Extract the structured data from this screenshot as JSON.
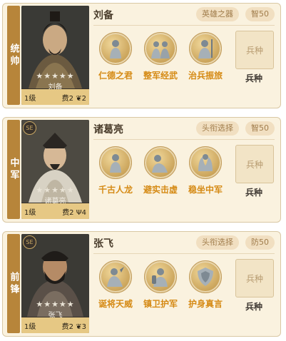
{
  "teams": [
    {
      "position": "统帅",
      "hero": {
        "name": "刘备",
        "level": "1级",
        "cost": "费2",
        "extra": "2",
        "stars": "★★★★★",
        "badge": ""
      },
      "tags": [
        "英雄之器",
        "智50"
      ],
      "skills": [
        {
          "name": "仁德之君",
          "icon": "statue-icon"
        },
        {
          "name": "整军经武",
          "icon": "soldiers-icon"
        },
        {
          "name": "治兵振旅",
          "icon": "general-icon"
        }
      ],
      "troop": {
        "button": "兵种",
        "label": "兵种"
      }
    },
    {
      "position": "中军",
      "hero": {
        "name": "诸葛亮",
        "level": "1级",
        "cost": "费2",
        "extra": "4",
        "stars": "★★★★★",
        "badge": "SE"
      },
      "tags": [
        "头衔选择",
        "智50"
      ],
      "skills": [
        {
          "name": "千古人龙",
          "icon": "statue-icon"
        },
        {
          "name": "避实击虚",
          "icon": "kneeling-icon"
        },
        {
          "name": "稳坐中军",
          "icon": "hands-icon"
        }
      ],
      "troop": {
        "button": "兵种",
        "label": "兵种"
      }
    },
    {
      "position": "前锋",
      "hero": {
        "name": "张飞",
        "level": "1级",
        "cost": "费2",
        "extra": "3",
        "stars": "★★★★★",
        "badge": "SE"
      },
      "tags": [
        "头衔选择",
        "防50"
      ],
      "skills": [
        {
          "name": "诞将天威",
          "icon": "warrior-icon"
        },
        {
          "name": "镇卫护军",
          "icon": "guard-icon"
        },
        {
          "name": "护身真言",
          "icon": "shield-icon"
        }
      ],
      "troop": {
        "button": "兵种",
        "label": "兵种"
      }
    }
  ]
}
